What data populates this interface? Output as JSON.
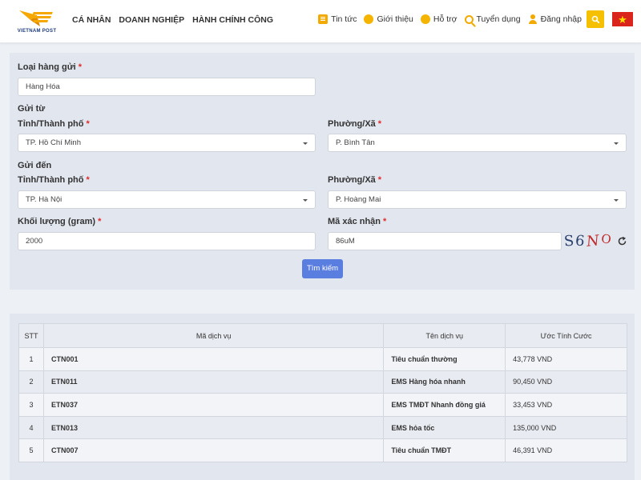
{
  "header": {
    "logo_text": "VIETNAM POST",
    "nav": [
      "CÁ NHÂN",
      "DOANH NGHIỆP",
      "HÀNH CHÍNH CÔNG"
    ],
    "top_links": [
      {
        "label": "Tin tức",
        "icon": "newspaper-icon"
      },
      {
        "label": "Giới thiệu",
        "icon": "info-icon"
      },
      {
        "label": "Hỗ trợ",
        "icon": "support-icon"
      },
      {
        "label": "Tuyển dụng",
        "icon": "recruit-search-icon"
      },
      {
        "label": "Đăng nhập",
        "icon": "user-icon"
      }
    ],
    "flag_star": "★",
    "accent_color": "#f5c000",
    "flag_color": "#da251d"
  },
  "form": {
    "goods_type_label": "Loại hàng gửi",
    "goods_type_value": "Hàng Hóa",
    "from_heading": "Gửi từ",
    "from_province_label": "Tỉnh/Thành phố",
    "from_province_value": "TP. Hồ Chí Minh",
    "from_ward_label": "Phường/Xã",
    "from_ward_value": "P. Bình Tân",
    "to_heading": "Gửi đến",
    "to_province_label": "Tỉnh/Thành phố",
    "to_province_value": "TP. Hà Nội",
    "to_ward_label": "Phường/Xã",
    "to_ward_value": "P. Hoàng Mai",
    "weight_label": "Khối lượng (gram)",
    "weight_value": "2000",
    "captcha_label": "Mã xác nhận",
    "captcha_value": "86uM",
    "captcha_chars": [
      "S",
      "6",
      "N",
      "O"
    ],
    "required_mark": "*",
    "submit_label": "Tìm kiếm",
    "submit_color": "#5a7de0"
  },
  "results": {
    "headers": [
      "STT",
      "Mã dịch vụ",
      "Tên dịch vụ",
      "Ước Tính Cước"
    ],
    "rows": [
      {
        "stt": "1",
        "code": "CTN001",
        "name": "Tiêu chuẩn thường",
        "fee": "43,778 VND"
      },
      {
        "stt": "2",
        "code": "ETN011",
        "name": "EMS Hàng hóa nhanh",
        "fee": "90,450 VND"
      },
      {
        "stt": "3",
        "code": "ETN037",
        "name": "EMS TMĐT Nhanh đồng giá",
        "fee": "33,453 VND"
      },
      {
        "stt": "4",
        "code": "ETN013",
        "name": "EMS hỏa tốc",
        "fee": "135,000 VND"
      },
      {
        "stt": "5",
        "code": "CTN007",
        "name": "Tiêu chuẩn TMĐT",
        "fee": "46,391 VND"
      }
    ]
  }
}
